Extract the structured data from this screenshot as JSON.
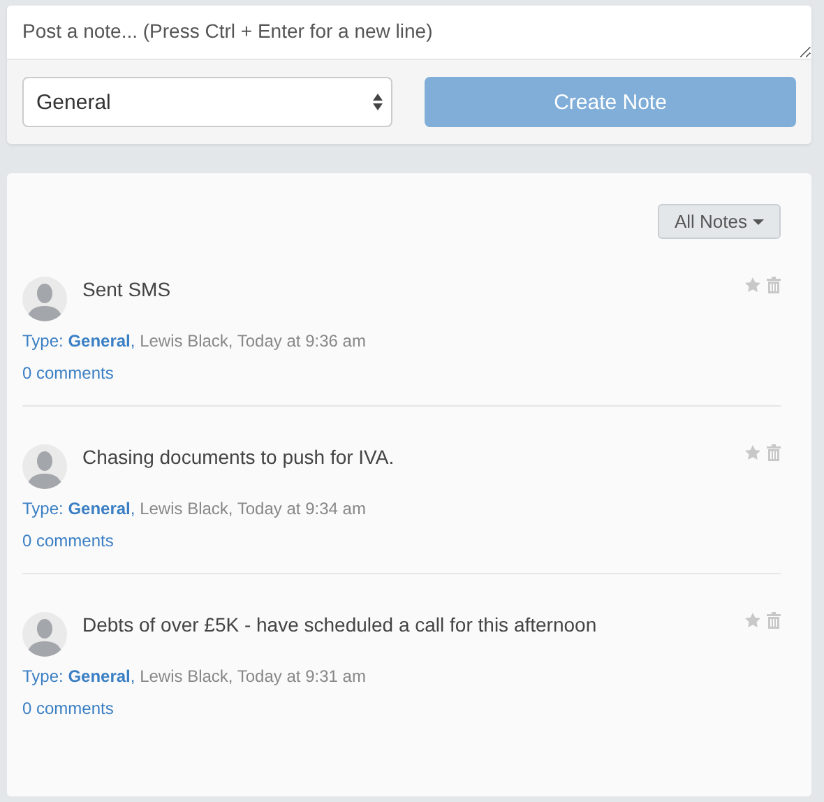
{
  "composer": {
    "placeholder": "Post a note... (Press Ctrl + Enter for a new line)",
    "category": "General",
    "submit": "Create Note"
  },
  "filter": {
    "label": "All Notes"
  },
  "notes": [
    {
      "text": "Sent SMS",
      "type_link": "Type: **General**,",
      "byline": "Lewis Black, Today at 9:36 am",
      "comments": "0 comments"
    },
    {
      "text": "Chasing documents to push for IVA.",
      "type_link": "Type: **General**,",
      "byline": "Lewis Black, Today at 9:34 am",
      "comments": "0 comments"
    },
    {
      "text": "Debts of over £5K - have scheduled a call for this afternoon",
      "type_link": "Type: **General**,",
      "byline": "Lewis Black, Today at 9:31 am",
      "comments": "0 comments"
    }
  ]
}
